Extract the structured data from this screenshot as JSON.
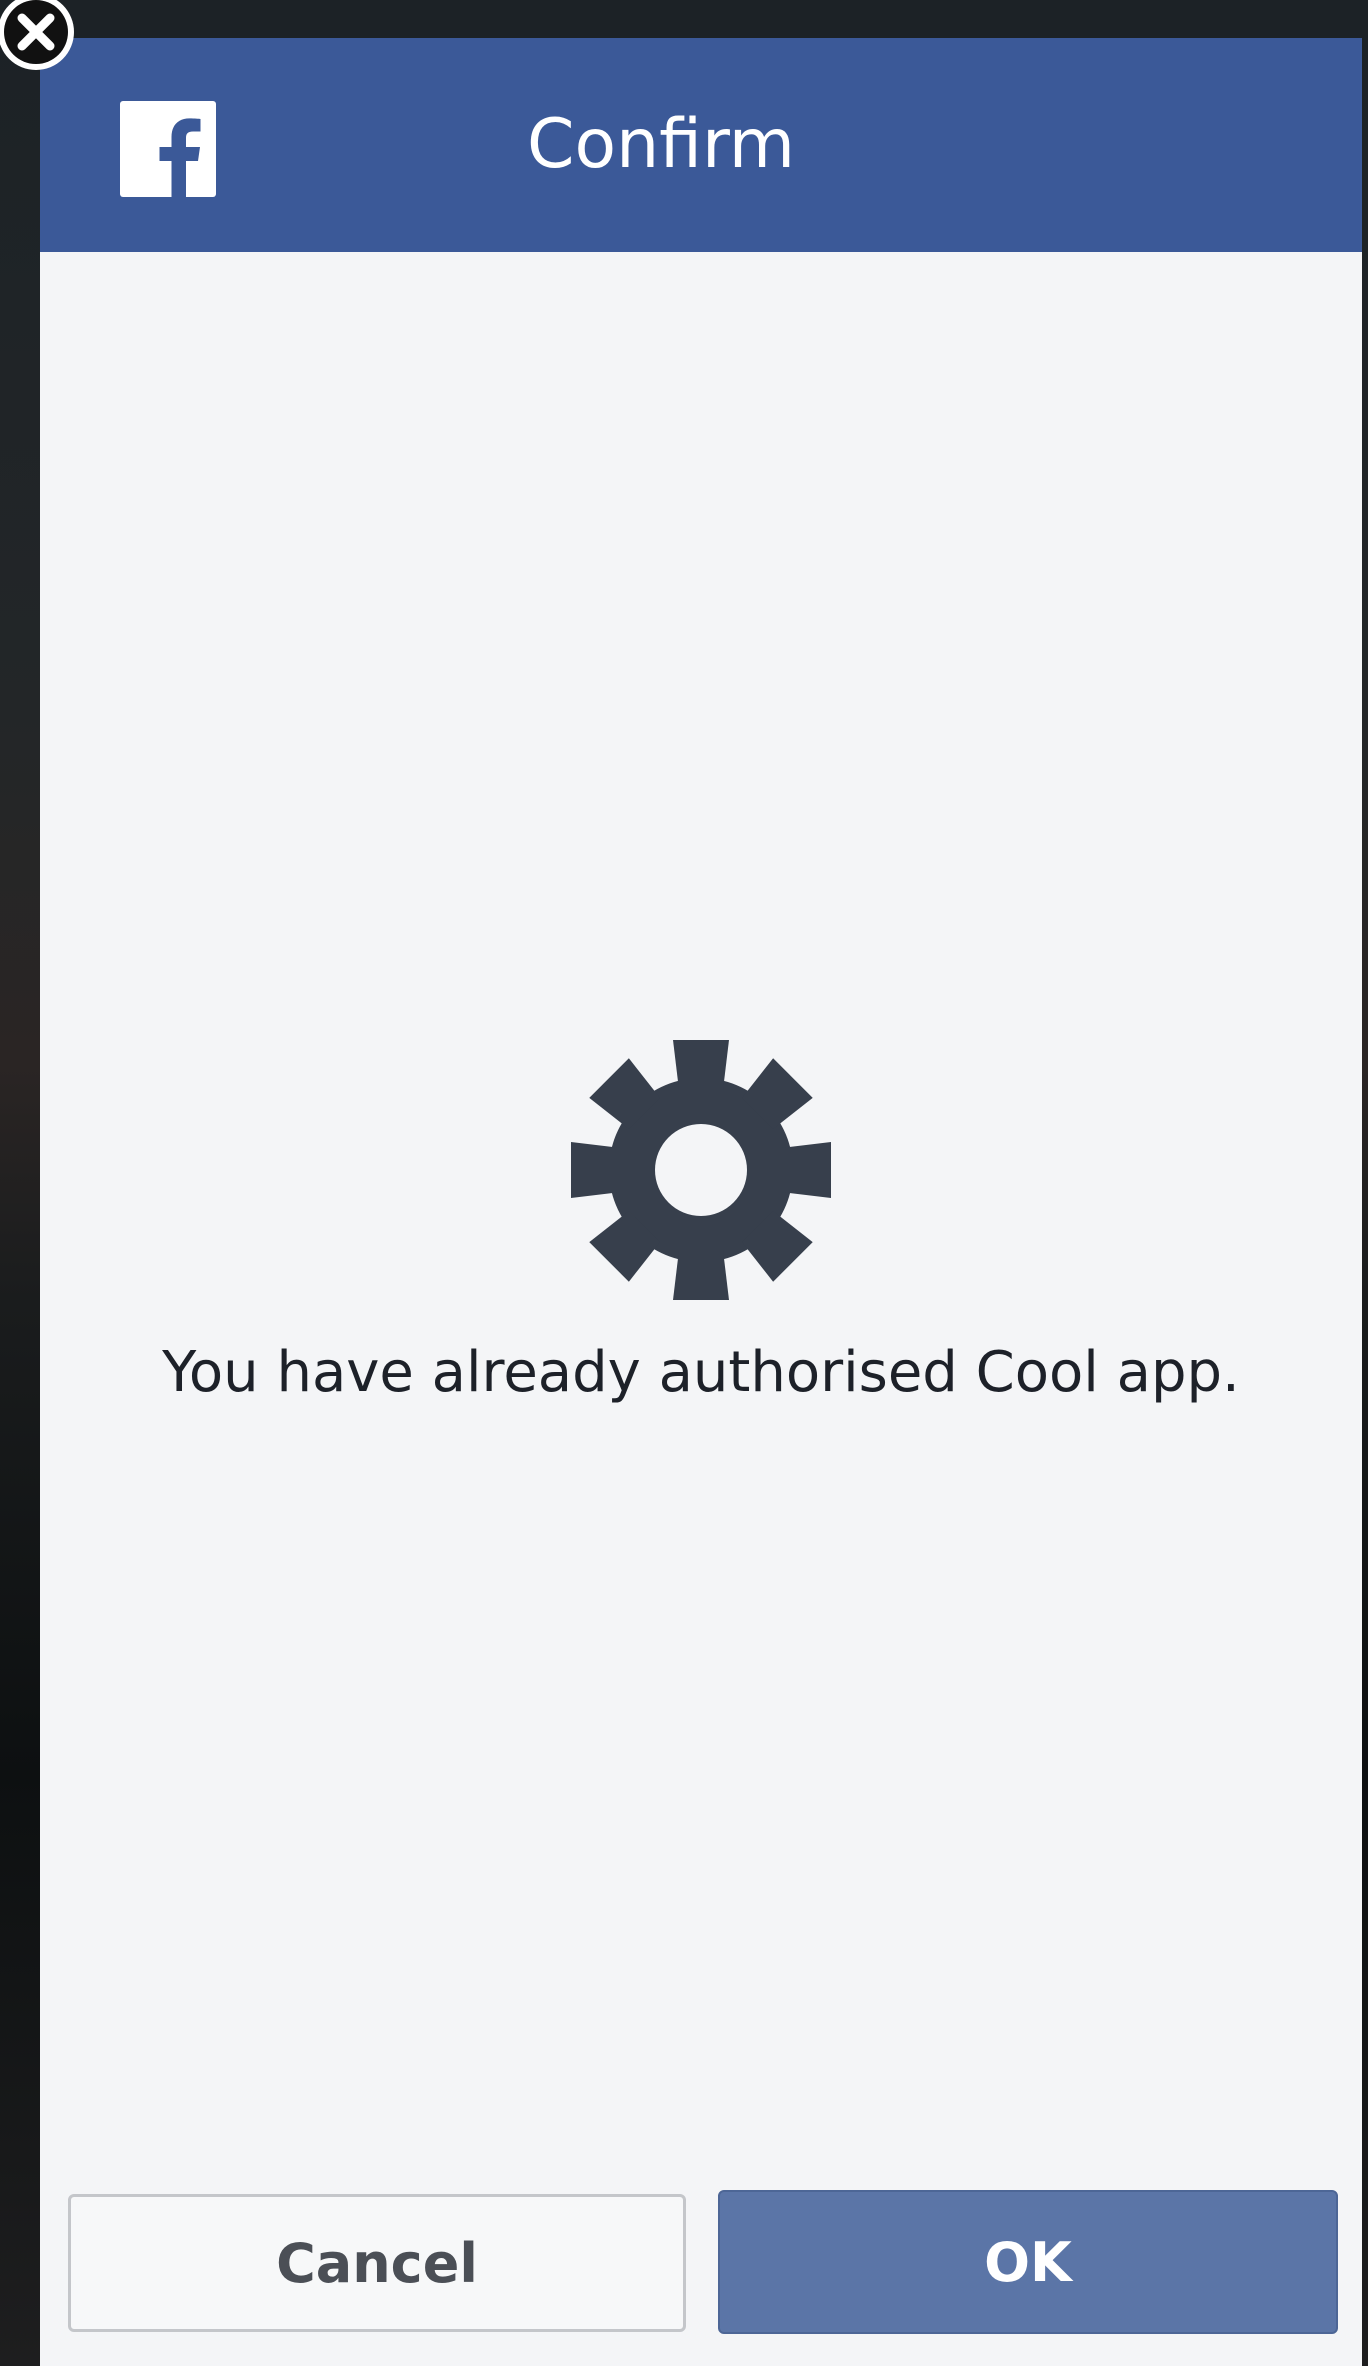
{
  "dialog": {
    "title": "Confirm",
    "message": "You have already authorised Cool app.",
    "buttons": {
      "cancel_label": "Cancel",
      "ok_label": "OK"
    }
  },
  "icons": {
    "close": "close-icon",
    "brand": "facebook-icon",
    "settings": "gear-icon"
  },
  "colors": {
    "header": "#3b5998",
    "ok_button": "#5b75a7",
    "body": "#f4f5f7",
    "gear": "#373f4c"
  }
}
